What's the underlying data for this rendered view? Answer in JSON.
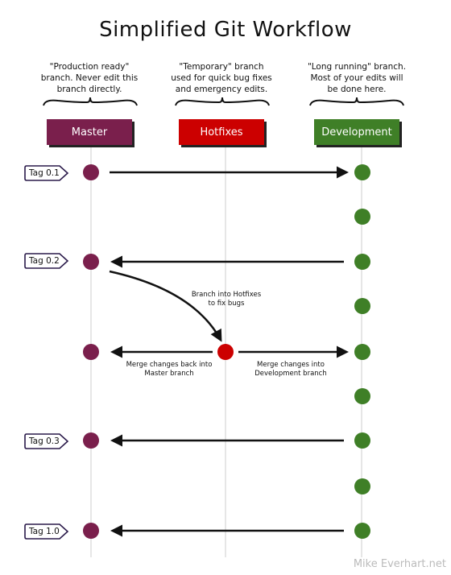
{
  "title": "Simplified Git Workflow",
  "colors": {
    "master": "#7a1f4c",
    "hotfixes": "#cc0000",
    "development": "#3f7f27"
  },
  "branches": {
    "master": {
      "label": "Master",
      "description": [
        "\"Production ready\"",
        "branch. Never edit this",
        "branch directly."
      ]
    },
    "hotfixes": {
      "label": "Hotfixes",
      "description": [
        "\"Temporary\" branch",
        "used for quick bug fixes",
        "and emergency edits."
      ]
    },
    "development": {
      "label": "Development",
      "description": [
        "\"Long running\" branch.",
        "Most of your edits will",
        "be done here."
      ]
    }
  },
  "tags": [
    "Tag 0.1",
    "Tag 0.2",
    "Tag 0.3",
    "Tag 1.0"
  ],
  "annotations": {
    "branch_into_hotfixes": [
      "Branch into Hotfixes",
      "to fix bugs"
    ],
    "merge_to_master": [
      "Merge changes back into",
      "Master branch"
    ],
    "merge_to_development": [
      "Merge changes into",
      "Development branch"
    ]
  },
  "credit": "Mike Everhart.net"
}
